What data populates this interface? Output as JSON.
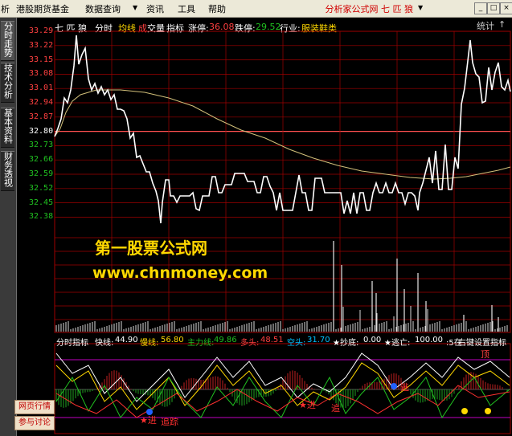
{
  "menubar": {
    "items": [
      "析",
      "港股期货基金",
      "数据查询",
      "资讯",
      "工具",
      "帮助"
    ],
    "title": "分析家公式网 七 匹 狼",
    "dropdown_marks": [
      "▼",
      "▼"
    ]
  },
  "sidetabs": [
    "分时走势",
    "技术分析",
    "基本资料",
    "财务透视"
  ],
  "chart_header": {
    "stock_name": "七 匹 狼",
    "mode": "分时",
    "avg_line": "均线",
    "volume_label_a": "成",
    "volume_label_b": "交量",
    "indicator_btn": "指标",
    "limit_up_label": "涨停:",
    "limit_up_value": "36.08",
    "limit_down_label": "跌停:",
    "limit_down_value": "29.52",
    "industry_label": "行业:",
    "industry_value": "服装鞋类",
    "stats_btn": "统计",
    "stats_mark": "↑"
  },
  "price_labels": [
    "33.29",
    "33.22",
    "33.15",
    "33.08",
    "33.01",
    "32.94",
    "32.87",
    "32.80",
    "32.73",
    "32.66",
    "32.59",
    "32.52",
    "32.45",
    "32.38"
  ],
  "watermark": {
    "cn": "第一股票公式网",
    "url": "www.chnmoney.com"
  },
  "indicator_bar": {
    "name": "分时指标",
    "fast_label": "快线:",
    "fast_value": "44.90",
    "slow_label": "慢线:",
    "slow_value": "56.80",
    "main_label": "主力线:",
    "main_value": "49.86",
    "bull_label": "多头:",
    "bull_value": "48.51",
    "bear_label": "空头:",
    "bear_value": "31.70",
    "bottom_label": "★抄底:",
    "bottom_value": "0.00",
    "escape_label": "★逃亡:",
    "escape_value": "100.00",
    "overflow": ":5在",
    "set_button": "右键设置指标"
  },
  "annotations": {
    "top": "顶",
    "buy_a": "★进",
    "buy_b": "★进",
    "buy_c": "追",
    "track": "追踪",
    "escape": "逃"
  },
  "buttons": {
    "web_quotes": "网页行情",
    "discuss": "参与讨论"
  },
  "colors": {
    "grid": "#a00000",
    "price_line": "#ffffff",
    "avg_line": "#d2c07a",
    "volume": "#e0e0e0",
    "up_red": "#ff4040",
    "down_green": "#20c020",
    "highlight": "#ffd800"
  }
}
